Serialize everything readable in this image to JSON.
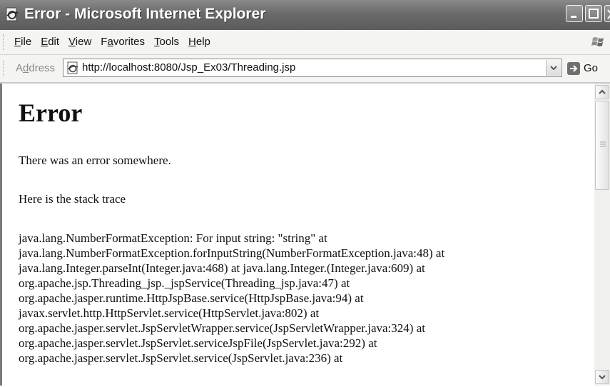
{
  "window": {
    "title": "Error - Microsoft Internet Explorer"
  },
  "menu": {
    "items": [
      {
        "pre": "",
        "key": "F",
        "post": "ile"
      },
      {
        "pre": "",
        "key": "E",
        "post": "dit"
      },
      {
        "pre": "",
        "key": "V",
        "post": "iew"
      },
      {
        "pre": "F",
        "key": "a",
        "post": "vorites"
      },
      {
        "pre": "",
        "key": "T",
        "post": "ools"
      },
      {
        "pre": "",
        "key": "H",
        "post": "elp"
      }
    ]
  },
  "address": {
    "label_pre": "A",
    "label_key": "d",
    "label_post": "dress",
    "url": "http://localhost:8080/Jsp_Ex03/Threading.jsp",
    "go_label": "Go"
  },
  "page": {
    "heading": "Error",
    "message": "There was an error somewhere.",
    "trace_intro": "Here is the stack trace",
    "trace_lines": [
      "java.lang.NumberFormatException: For input string: \"string\" at",
      "java.lang.NumberFormatException.forInputString(NumberFormatException.java:48) at",
      "java.lang.Integer.parseInt(Integer.java:468) at java.lang.Integer.(Integer.java:609) at",
      "org.apache.jsp.Threading_jsp._jspService(Threading_jsp.java:47) at",
      "org.apache.jasper.runtime.HttpJspBase.service(HttpJspBase.java:94) at",
      "javax.servlet.http.HttpServlet.service(HttpServlet.java:802) at",
      "org.apache.jasper.servlet.JspServletWrapper.service(JspServletWrapper.java:324) at",
      "org.apache.jasper.servlet.JspServlet.serviceJspFile(JspServlet.java:292) at",
      "org.apache.jasper.servlet.JspServlet.service(JspServlet.java:236) at"
    ]
  },
  "icons": {
    "title": "ie-page-icon",
    "minimize": "minimize-icon",
    "maximize": "maximize-icon",
    "close": "close-icon",
    "windows_flag": "windows-flag-icon",
    "address_page": "page-icon",
    "dropdown": "chevron-down-icon",
    "go": "go-arrow-icon",
    "scroll_up": "scroll-up-icon",
    "scroll_down": "scroll-down-icon"
  },
  "colors": {
    "titlebar": "#6a6a6a",
    "toolbar": "#f4f4f2",
    "text": "#111111"
  }
}
